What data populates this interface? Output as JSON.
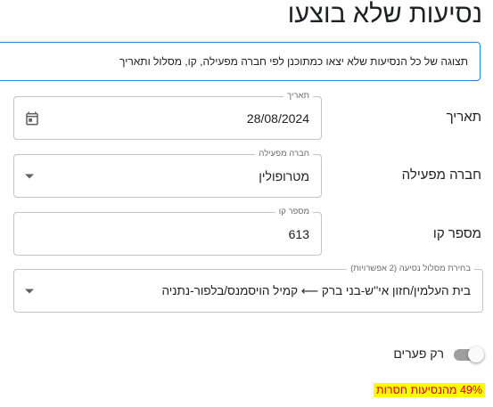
{
  "page": {
    "title": "נסיעות שלא בוצעו"
  },
  "info": {
    "text": "תצוגה של כל הנסיעות שלא יצאו כמתוכנן לפי חברה מפעילה, קו, מסלול ותאריך"
  },
  "form": {
    "date": {
      "label": "תאריך",
      "legend": "תאריך",
      "value": "28/08/2024",
      "icon": "calendar-icon"
    },
    "operator": {
      "label": "חברה מפעילה",
      "legend": "חברה מפעילה",
      "value": "מטרופולין",
      "icon": "dropdown-arrow-icon"
    },
    "line_number": {
      "label": "מספר קו",
      "legend": "מספר קו",
      "value": "613"
    },
    "route": {
      "legend": "בחירת מסלול נסיעה (2 אפשרויות)",
      "value": "בית העלמין/חזון אי''ש-בני ברק ⟵ קמיל הויסמנס/בלפור-נתניה",
      "icon": "dropdown-arrow-icon"
    }
  },
  "toggle": {
    "label": "רק פערים",
    "checked": false
  },
  "warning": {
    "text": "49% מהנסיעות חסרות"
  },
  "colors": {
    "accent": "#1e88e5",
    "warning_bg": "#ffff00",
    "warning_text": "#d50000"
  }
}
